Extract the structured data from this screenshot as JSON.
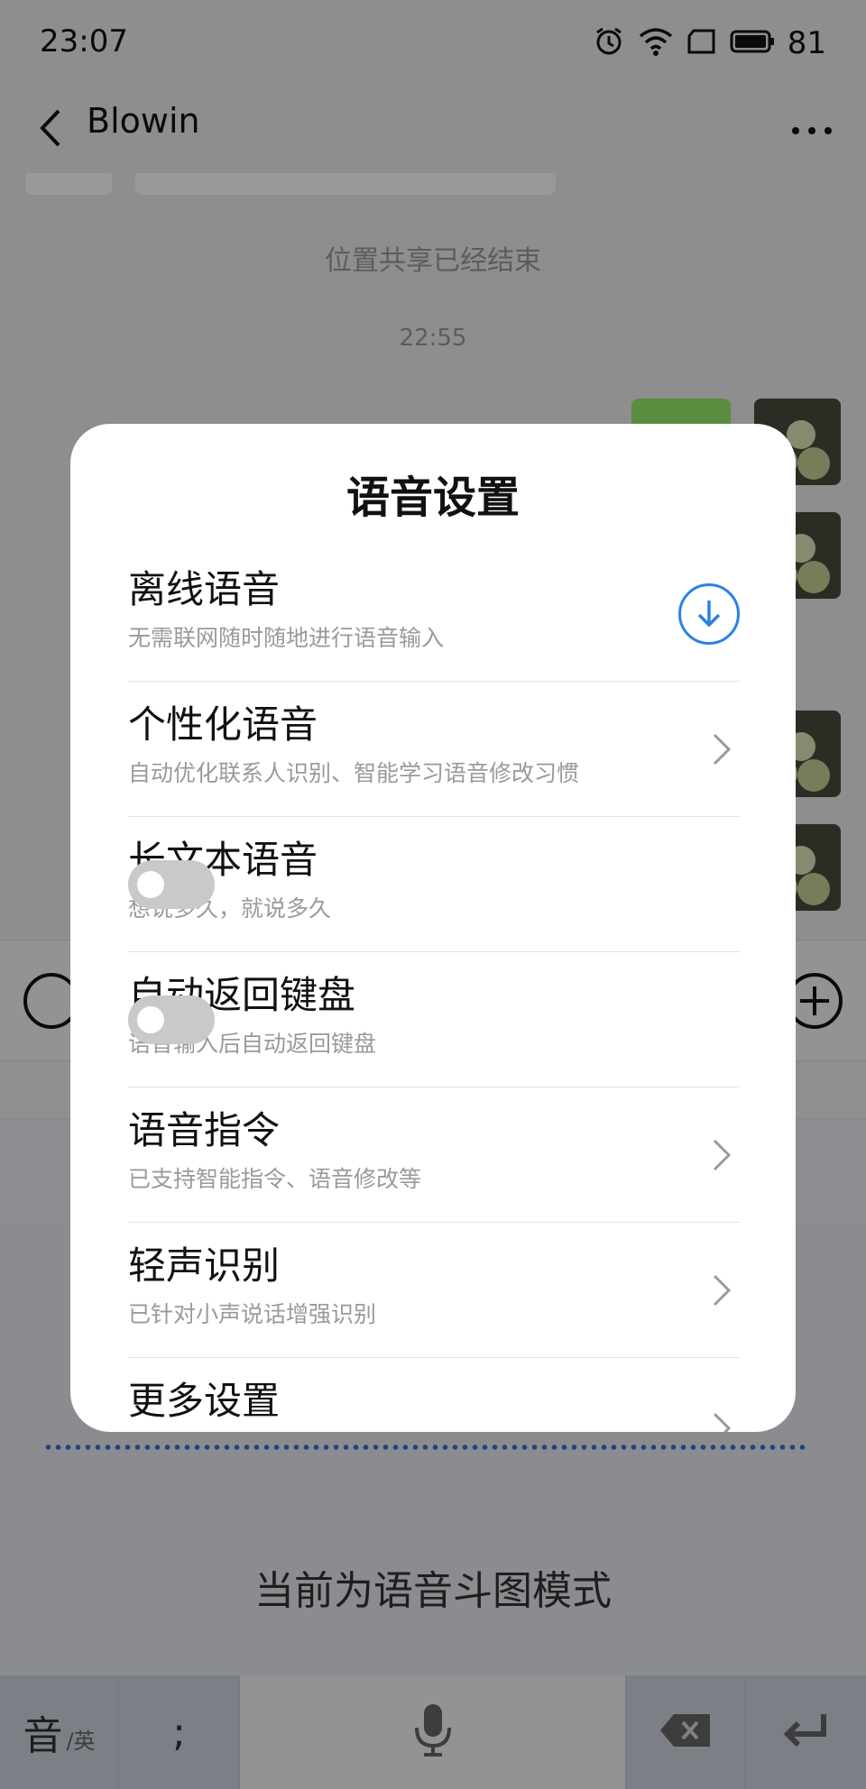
{
  "status_bar": {
    "time": "23:07",
    "battery": "81",
    "icons": [
      "alarm-icon",
      "wifi-icon",
      "sim-icon",
      "battery-icon"
    ]
  },
  "chat": {
    "title": "Blowin",
    "system_message": "位置共享已经结束",
    "timestamp": "22:55"
  },
  "dialog": {
    "title": "语音设置",
    "items": [
      {
        "title": "离线语音",
        "desc": "无需联网随时随地进行语音输入",
        "control": "download"
      },
      {
        "title": "个性化语音",
        "desc": "自动优化联系人识别、智能学习语音修改习惯",
        "control": "chevron"
      },
      {
        "title": "长文本语音",
        "desc": "想说多久，就说多久",
        "control": "toggle",
        "on": false
      },
      {
        "title": "自动返回键盘",
        "desc": "语音输入后自动返回键盘",
        "control": "toggle",
        "on": false
      },
      {
        "title": "语音指令",
        "desc": "已支持智能指令、语音修改等",
        "control": "chevron"
      },
      {
        "title": "轻声识别",
        "desc": "已针对小声说话增强识别",
        "control": "chevron"
      },
      {
        "title": "更多设置",
        "desc": "",
        "control": "chevron"
      }
    ]
  },
  "keyboard": {
    "voice_mode_text": "当前为语音斗图模式",
    "lang_key_main": "音",
    "lang_key_sub": "/英",
    "punct_key": ";"
  },
  "colors": {
    "accent_blue": "#2a82e4",
    "bubble_green": "#95ec69",
    "toggle_off": "#c9c9c9",
    "wave_blue": "#3a6fd8"
  }
}
